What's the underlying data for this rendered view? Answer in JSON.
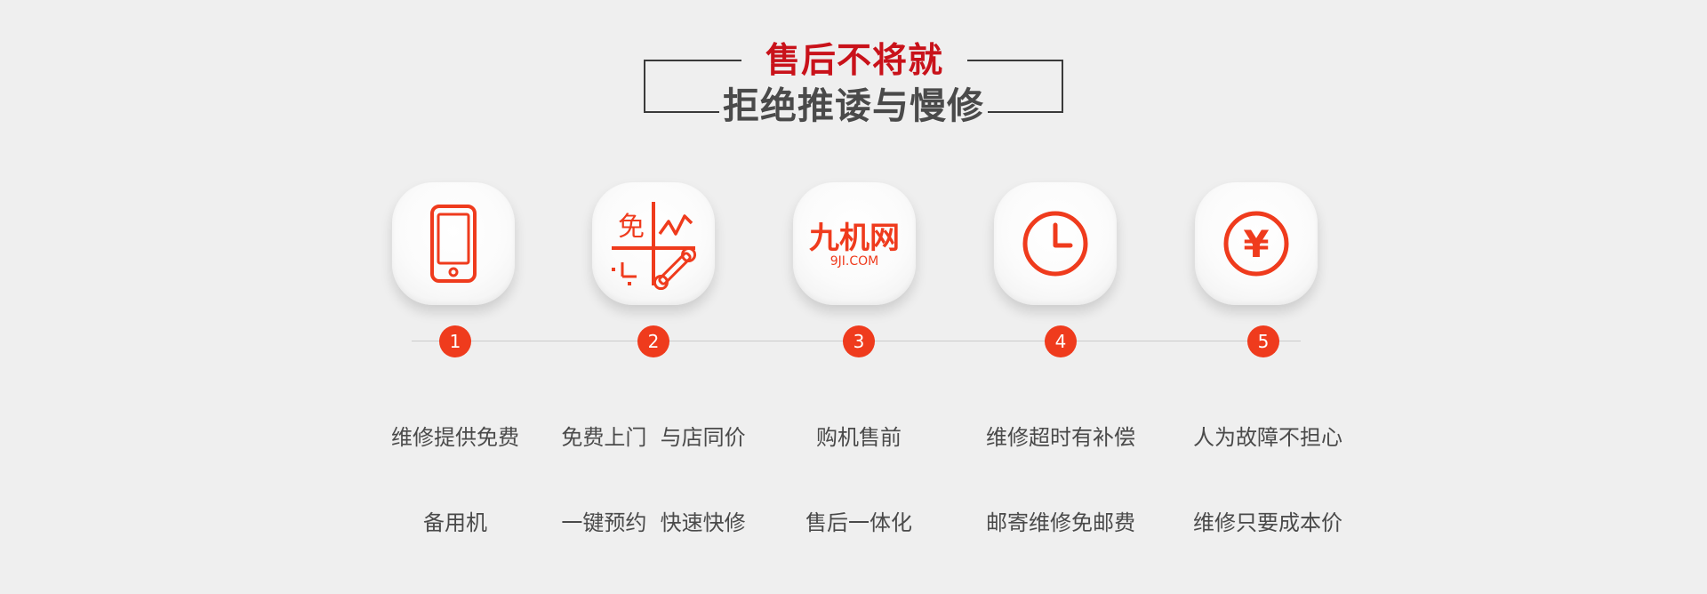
{
  "title": {
    "line1": "售后不将就",
    "line2": "拒绝推诿与慢修"
  },
  "steps": [
    {
      "num": "1",
      "icon": "phone-icon",
      "line1": "维修提供免费",
      "line2": "备用机"
    },
    {
      "num": "2",
      "icon": "free-door-repair-icon",
      "line1": "免费上门  与店同价",
      "line2": "一键预约  快速快修",
      "icon_text": "免"
    },
    {
      "num": "3",
      "icon": "jiuji-logo-icon",
      "line1": "购机售前",
      "line2": "售后一体化",
      "logo_cn": "九机网",
      "logo_en": "9JI.COM"
    },
    {
      "num": "4",
      "icon": "clock-icon",
      "line1": "维修超时有补偿",
      "line2": "邮寄维修免邮费"
    },
    {
      "num": "5",
      "icon": "yen-icon",
      "line1": "人为故障不担心",
      "line2": "维修只要成本价",
      "symbol": "¥"
    }
  ],
  "colors": {
    "accent": "#ef3b1d",
    "title_red": "#c9121a",
    "text_gray": "#4a4a4a",
    "background": "#efefef"
  }
}
